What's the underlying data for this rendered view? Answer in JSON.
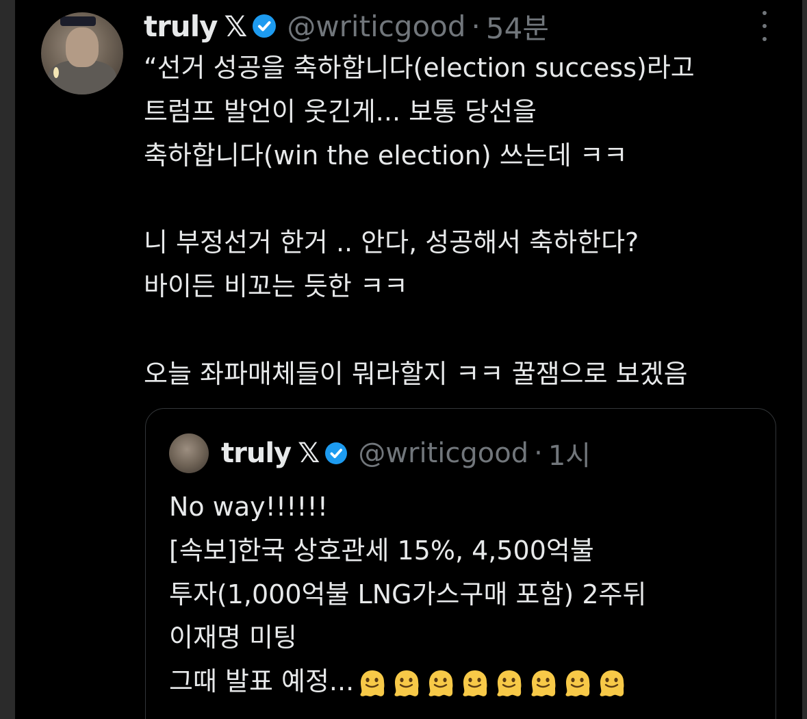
{
  "tweet": {
    "display_name": "truly",
    "x_mark": "𝕏",
    "handle": "@writicgood",
    "separator": "·",
    "time": "54분",
    "lines": [
      "“선거 성공을 축하합니다(election success)라고",
      "트럼프 발언이 웃긴게... 보통 당선을",
      "축하합니다(win the election) 쓰는데 ㅋㅋ",
      "",
      "니 부정선거 한거 .. 안다, 성공해서 축하한다?",
      "바이든 비꼬는 듯한 ㅋㅋ",
      "",
      "오늘 좌파매체들이 뭐라할지 ㅋㅋ 꿀잼으로 보겠음"
    ]
  },
  "quoted": {
    "display_name": "truly",
    "x_mark": "𝕏",
    "handle": "@writicgood",
    "separator": "·",
    "time": "1시",
    "lines": [
      "No way!!!!!!",
      "[속보]한국 상호관세 15%, 4,500억불",
      "투자(1,000억불 LNG가스구매 포함) 2주뒤",
      "이재명 미팅",
      "그때 발표 예정..."
    ],
    "emoji_count": 8,
    "emoji_name": "melting-face"
  },
  "colors": {
    "background": "#000000",
    "text": "#e7e9ea",
    "muted": "#71767b",
    "verified": "#1d9bf0",
    "border": "#333639",
    "emoji": "#f7c948"
  }
}
